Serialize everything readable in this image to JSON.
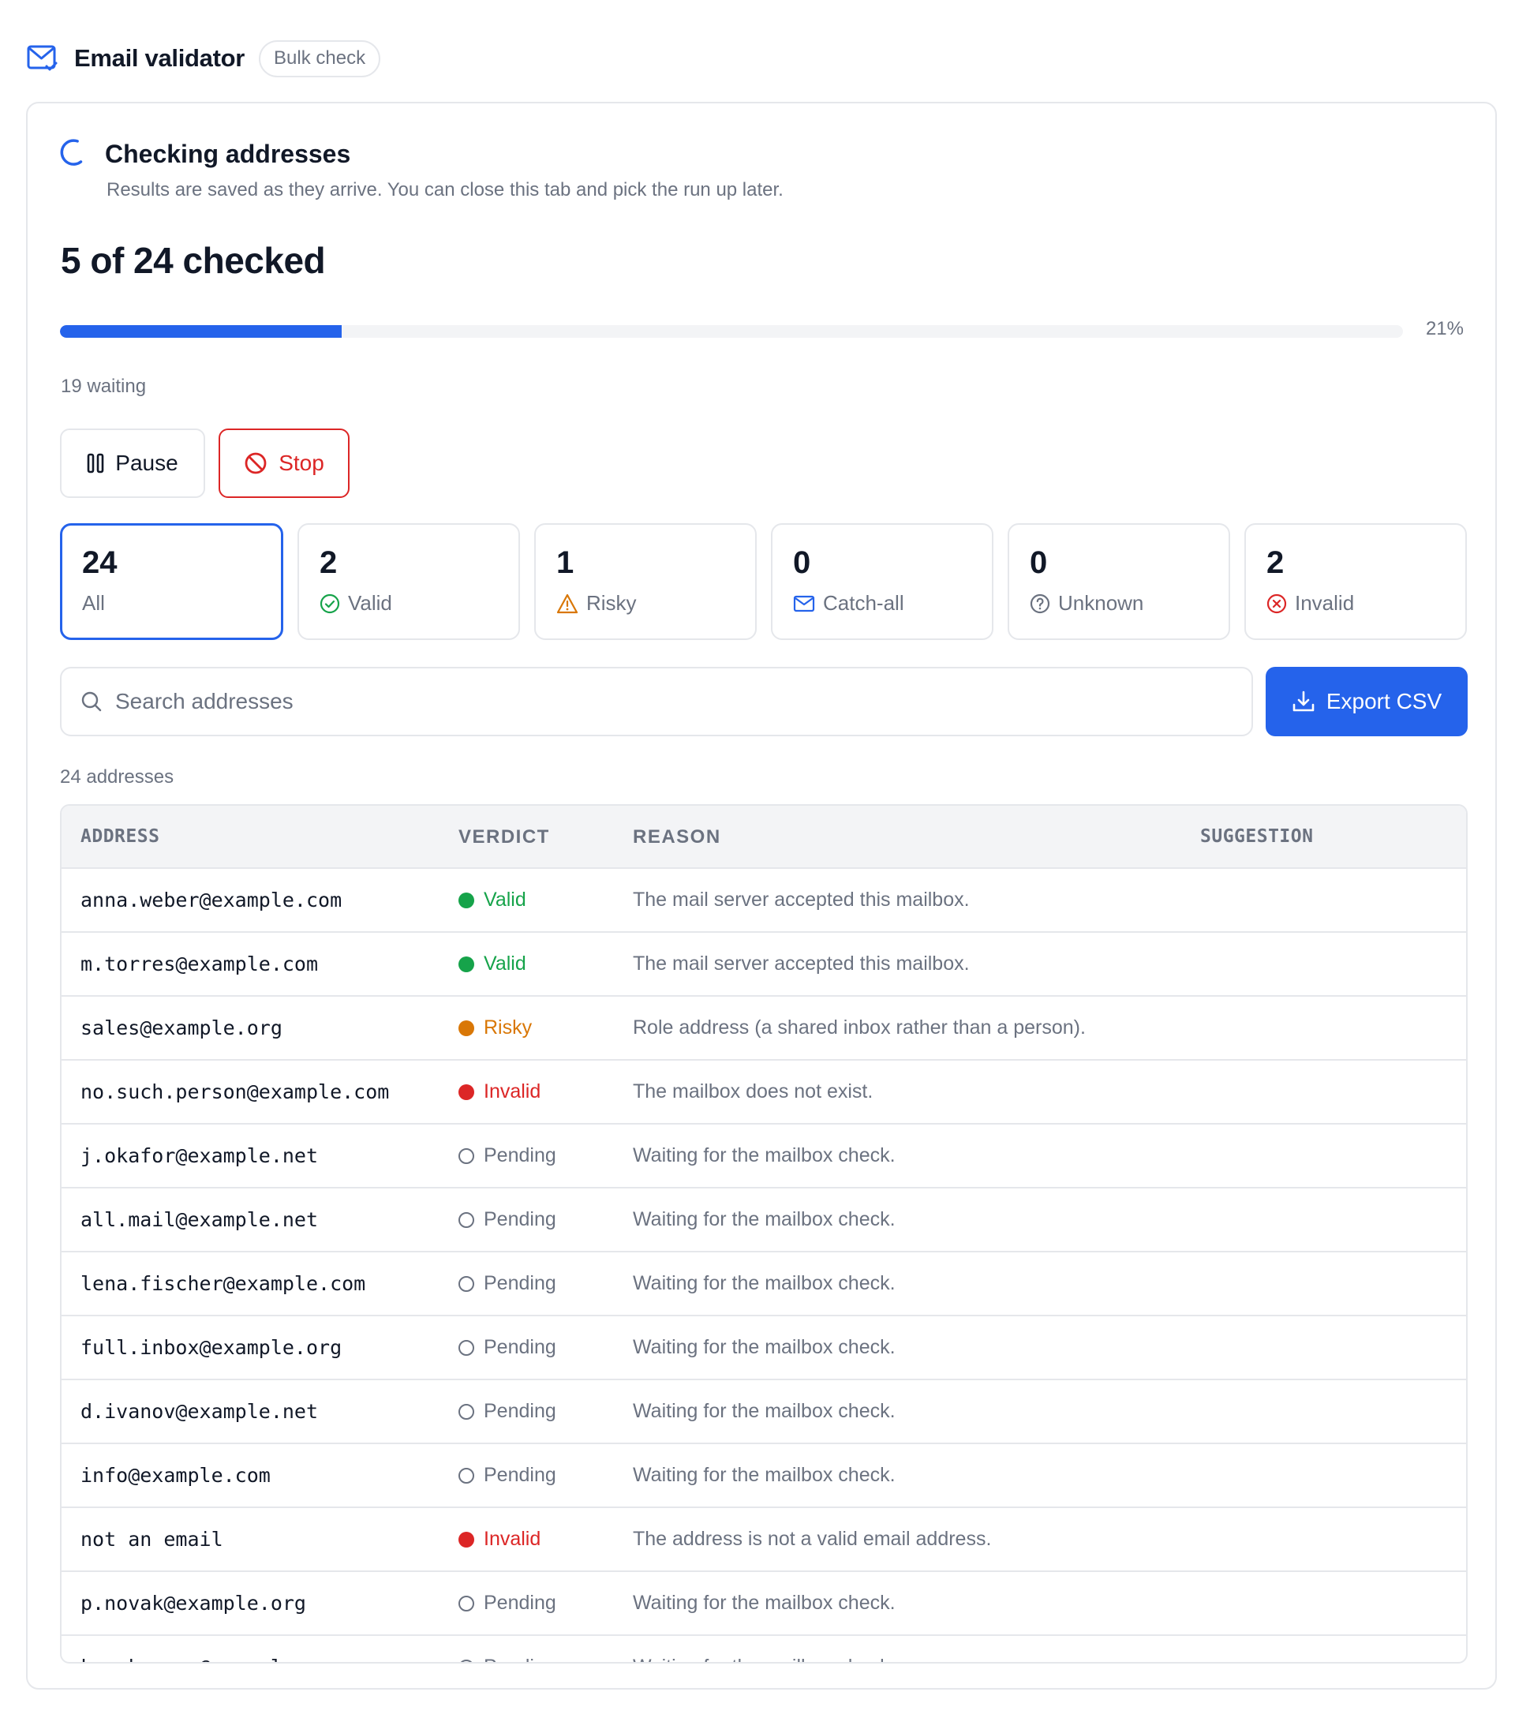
{
  "header": {
    "title": "Email validator",
    "badge": "Bulk check"
  },
  "status": {
    "title": "Checking addresses",
    "subtitle": "Results are saved as they arrive. You can close this tab and pick the run up later.",
    "checked_label": "5 of 24 checked",
    "progress_fraction": 0.21,
    "progress_label": "21%",
    "waiting_label": "19 waiting"
  },
  "actions": {
    "pause_label": "Pause",
    "stop_label": "Stop",
    "export_label": "Export CSV"
  },
  "filters": [
    {
      "count": "24",
      "label": "All",
      "icon": "none",
      "active": true
    },
    {
      "count": "2",
      "label": "Valid",
      "icon": "check-circle-icon",
      "active": false
    },
    {
      "count": "1",
      "label": "Risky",
      "icon": "warning-triangle-icon",
      "active": false
    },
    {
      "count": "0",
      "label": "Catch-all",
      "icon": "envelope-icon",
      "active": false
    },
    {
      "count": "0",
      "label": "Unknown",
      "icon": "question-circle-icon",
      "active": false
    },
    {
      "count": "2",
      "label": "Invalid",
      "icon": "x-circle-icon",
      "active": false
    }
  ],
  "search": {
    "placeholder": "Search addresses",
    "value": ""
  },
  "table": {
    "count_label": "24 addresses",
    "columns": [
      "ADDRESS",
      "VERDICT",
      "REASON",
      "SUGGESTION"
    ],
    "rows": [
      {
        "address": "anna.weber@example.com",
        "verdict": "Valid",
        "kind": "valid",
        "reason": "The mail server accepted this mailbox."
      },
      {
        "address": "m.torres@example.com",
        "verdict": "Valid",
        "kind": "valid",
        "reason": "The mail server accepted this mailbox."
      },
      {
        "address": "sales@example.org",
        "verdict": "Risky",
        "kind": "risky",
        "reason": "Role address (a shared inbox rather than a person)."
      },
      {
        "address": "no.such.person@example.com",
        "verdict": "Invalid",
        "kind": "invalid",
        "reason": "The mailbox does not exist."
      },
      {
        "address": "j.okafor@example.net",
        "verdict": "Pending",
        "kind": "pending",
        "reason": "Waiting for the mailbox check."
      },
      {
        "address": "all.mail@example.net",
        "verdict": "Pending",
        "kind": "pending",
        "reason": "Waiting for the mailbox check."
      },
      {
        "address": "lena.fischer@example.com",
        "verdict": "Pending",
        "kind": "pending",
        "reason": "Waiting for the mailbox check."
      },
      {
        "address": "full.inbox@example.org",
        "verdict": "Pending",
        "kind": "pending",
        "reason": "Waiting for the mailbox check."
      },
      {
        "address": "d.ivanov@example.net",
        "verdict": "Pending",
        "kind": "pending",
        "reason": "Waiting for the mailbox check."
      },
      {
        "address": "info@example.com",
        "verdict": "Pending",
        "kind": "pending",
        "reason": "Waiting for the mailbox check."
      },
      {
        "address": "not an email",
        "verdict": "Invalid",
        "kind": "invalid",
        "reason": "The address is not a valid email address."
      },
      {
        "address": "p.novak@example.org",
        "verdict": "Pending",
        "kind": "pending",
        "reason": "Waiting for the mailbox check."
      },
      {
        "address": "k.nakamura@example.com",
        "verdict": "Pending",
        "kind": "pending",
        "reason": "Waiting for the mailbox check."
      }
    ]
  },
  "colors": {
    "accent": "#2563eb",
    "valid": "#16a34a",
    "risky": "#d97706",
    "invalid": "#dc2626",
    "muted": "#6b7280"
  }
}
